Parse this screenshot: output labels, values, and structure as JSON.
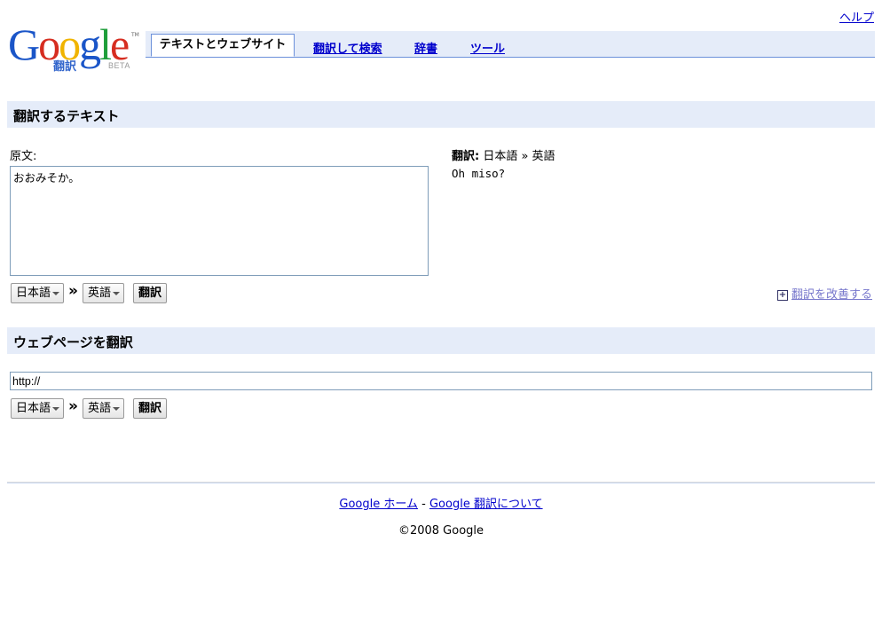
{
  "header": {
    "help": "ヘルプ",
    "logo": {
      "text": "Google",
      "sub": "翻訳",
      "beta": "BETA",
      "tm": "TM"
    },
    "tabs": [
      {
        "label": "テキストとウェブサイト",
        "active": true
      },
      {
        "label": "翻訳して検索",
        "active": false
      },
      {
        "label": "辞書",
        "active": false
      },
      {
        "label": "ツール",
        "active": false
      }
    ]
  },
  "text_section": {
    "title": "翻訳するテキスト",
    "source_label": "原文:",
    "source_text": "おおみそか。",
    "result_label_prefix": "翻訳:",
    "result_label_langs": "日本語 » 英語",
    "result_text": "Oh miso?",
    "from_lang": "日本語",
    "to_lang": "英語",
    "translate_button": "翻訳",
    "improve_link": "翻訳を改善する"
  },
  "web_section": {
    "title": "ウェブページを翻訳",
    "url_value": "http://",
    "from_lang": "日本語",
    "to_lang": "英語",
    "translate_button": "翻訳"
  },
  "footer": {
    "home_link": "Google ホーム",
    "separator": "-",
    "about_link": "Google 翻訳について",
    "copyright": "©2008 Google"
  },
  "colors": {
    "section_bg": "#e5ecf9",
    "tab_border": "#6b90da",
    "link": "#0000cc"
  },
  "raquo": "»"
}
